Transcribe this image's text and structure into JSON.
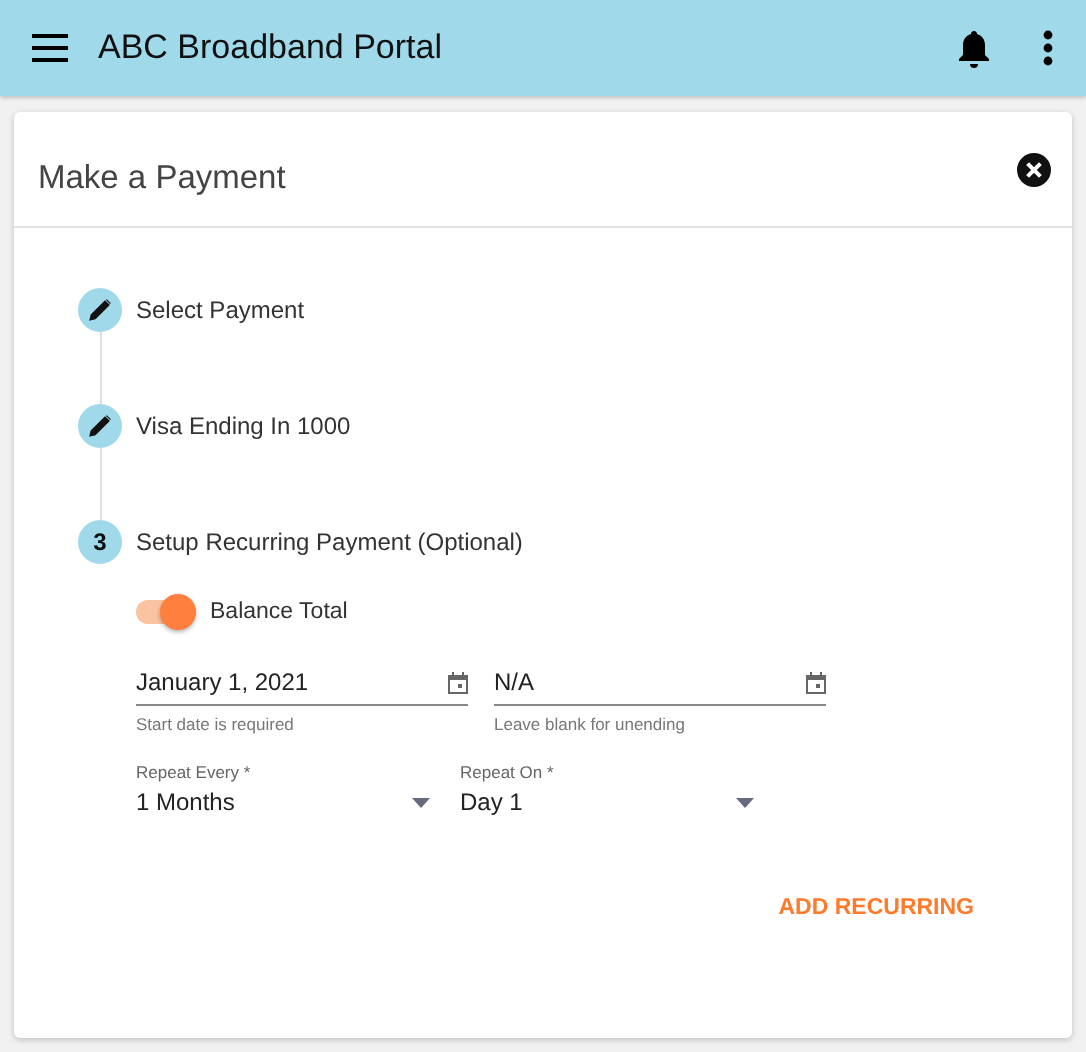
{
  "app_bar": {
    "title": "ABC Broadband Portal"
  },
  "dialog": {
    "title": "Make a Payment",
    "steps": [
      {
        "kind": "edit",
        "label": "Select Payment"
      },
      {
        "kind": "edit",
        "label": "Visa Ending In 1000"
      },
      {
        "kind": "number",
        "number": "3",
        "label": "Setup Recurring Payment (Optional)"
      }
    ],
    "toggle": {
      "label": "Balance Total",
      "on": true
    },
    "date_fields": [
      {
        "value": "January 1, 2021",
        "hint": "Start date is required"
      },
      {
        "value": "N/A",
        "hint": "Leave blank for unending"
      }
    ],
    "selects": [
      {
        "label": "Repeat Every *",
        "value": "1 Months"
      },
      {
        "label": "Repeat On *",
        "value": "Day 1"
      }
    ],
    "action": "ADD RECURRING"
  }
}
